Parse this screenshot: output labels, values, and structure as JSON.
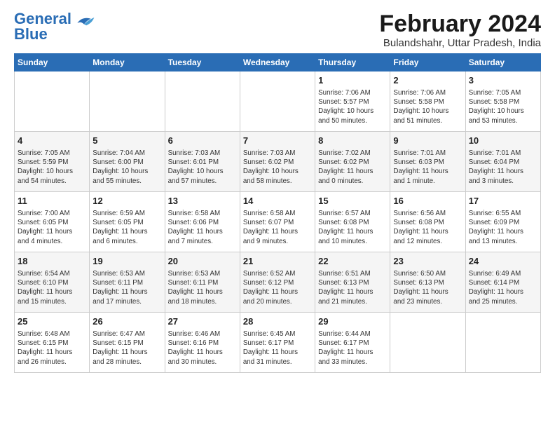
{
  "header": {
    "logo_line1": "General",
    "logo_line2": "Blue",
    "title": "February 2024",
    "subtitle": "Bulandshahr, Uttar Pradesh, India"
  },
  "weekdays": [
    "Sunday",
    "Monday",
    "Tuesday",
    "Wednesday",
    "Thursday",
    "Friday",
    "Saturday"
  ],
  "weeks": [
    [
      {
        "day": "",
        "info": ""
      },
      {
        "day": "",
        "info": ""
      },
      {
        "day": "",
        "info": ""
      },
      {
        "day": "",
        "info": ""
      },
      {
        "day": "1",
        "info": "Sunrise: 7:06 AM\nSunset: 5:57 PM\nDaylight: 10 hours\nand 50 minutes."
      },
      {
        "day": "2",
        "info": "Sunrise: 7:06 AM\nSunset: 5:58 PM\nDaylight: 10 hours\nand 51 minutes."
      },
      {
        "day": "3",
        "info": "Sunrise: 7:05 AM\nSunset: 5:58 PM\nDaylight: 10 hours\nand 53 minutes."
      }
    ],
    [
      {
        "day": "4",
        "info": "Sunrise: 7:05 AM\nSunset: 5:59 PM\nDaylight: 10 hours\nand 54 minutes."
      },
      {
        "day": "5",
        "info": "Sunrise: 7:04 AM\nSunset: 6:00 PM\nDaylight: 10 hours\nand 55 minutes."
      },
      {
        "day": "6",
        "info": "Sunrise: 7:03 AM\nSunset: 6:01 PM\nDaylight: 10 hours\nand 57 minutes."
      },
      {
        "day": "7",
        "info": "Sunrise: 7:03 AM\nSunset: 6:02 PM\nDaylight: 10 hours\nand 58 minutes."
      },
      {
        "day": "8",
        "info": "Sunrise: 7:02 AM\nSunset: 6:02 PM\nDaylight: 11 hours\nand 0 minutes."
      },
      {
        "day": "9",
        "info": "Sunrise: 7:01 AM\nSunset: 6:03 PM\nDaylight: 11 hours\nand 1 minute."
      },
      {
        "day": "10",
        "info": "Sunrise: 7:01 AM\nSunset: 6:04 PM\nDaylight: 11 hours\nand 3 minutes."
      }
    ],
    [
      {
        "day": "11",
        "info": "Sunrise: 7:00 AM\nSunset: 6:05 PM\nDaylight: 11 hours\nand 4 minutes."
      },
      {
        "day": "12",
        "info": "Sunrise: 6:59 AM\nSunset: 6:05 PM\nDaylight: 11 hours\nand 6 minutes."
      },
      {
        "day": "13",
        "info": "Sunrise: 6:58 AM\nSunset: 6:06 PM\nDaylight: 11 hours\nand 7 minutes."
      },
      {
        "day": "14",
        "info": "Sunrise: 6:58 AM\nSunset: 6:07 PM\nDaylight: 11 hours\nand 9 minutes."
      },
      {
        "day": "15",
        "info": "Sunrise: 6:57 AM\nSunset: 6:08 PM\nDaylight: 11 hours\nand 10 minutes."
      },
      {
        "day": "16",
        "info": "Sunrise: 6:56 AM\nSunset: 6:08 PM\nDaylight: 11 hours\nand 12 minutes."
      },
      {
        "day": "17",
        "info": "Sunrise: 6:55 AM\nSunset: 6:09 PM\nDaylight: 11 hours\nand 13 minutes."
      }
    ],
    [
      {
        "day": "18",
        "info": "Sunrise: 6:54 AM\nSunset: 6:10 PM\nDaylight: 11 hours\nand 15 minutes."
      },
      {
        "day": "19",
        "info": "Sunrise: 6:53 AM\nSunset: 6:11 PM\nDaylight: 11 hours\nand 17 minutes."
      },
      {
        "day": "20",
        "info": "Sunrise: 6:53 AM\nSunset: 6:11 PM\nDaylight: 11 hours\nand 18 minutes."
      },
      {
        "day": "21",
        "info": "Sunrise: 6:52 AM\nSunset: 6:12 PM\nDaylight: 11 hours\nand 20 minutes."
      },
      {
        "day": "22",
        "info": "Sunrise: 6:51 AM\nSunset: 6:13 PM\nDaylight: 11 hours\nand 21 minutes."
      },
      {
        "day": "23",
        "info": "Sunrise: 6:50 AM\nSunset: 6:13 PM\nDaylight: 11 hours\nand 23 minutes."
      },
      {
        "day": "24",
        "info": "Sunrise: 6:49 AM\nSunset: 6:14 PM\nDaylight: 11 hours\nand 25 minutes."
      }
    ],
    [
      {
        "day": "25",
        "info": "Sunrise: 6:48 AM\nSunset: 6:15 PM\nDaylight: 11 hours\nand 26 minutes."
      },
      {
        "day": "26",
        "info": "Sunrise: 6:47 AM\nSunset: 6:15 PM\nDaylight: 11 hours\nand 28 minutes."
      },
      {
        "day": "27",
        "info": "Sunrise: 6:46 AM\nSunset: 6:16 PM\nDaylight: 11 hours\nand 30 minutes."
      },
      {
        "day": "28",
        "info": "Sunrise: 6:45 AM\nSunset: 6:17 PM\nDaylight: 11 hours\nand 31 minutes."
      },
      {
        "day": "29",
        "info": "Sunrise: 6:44 AM\nSunset: 6:17 PM\nDaylight: 11 hours\nand 33 minutes."
      },
      {
        "day": "",
        "info": ""
      },
      {
        "day": "",
        "info": ""
      }
    ]
  ]
}
